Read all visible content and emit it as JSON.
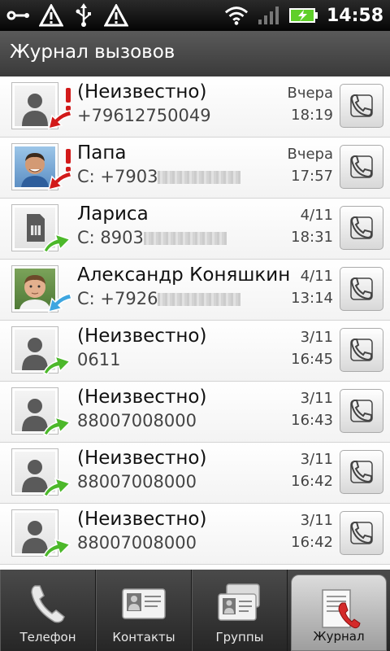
{
  "status_bar": {
    "time": "14:58",
    "icons": [
      "usb-debug-icon",
      "warning-icon",
      "usb-icon",
      "warning-icon",
      "wifi-icon",
      "signal-icon",
      "battery-charging-icon"
    ]
  },
  "header": {
    "title": "Журнал вызовов"
  },
  "call_log": [
    {
      "name": "(Неизвестно)",
      "number": "+79612750049",
      "number_hidden": false,
      "date": "Вчера",
      "time": "18:19",
      "type": "missed",
      "avatar": "silhouette"
    },
    {
      "name": "Папа",
      "number": "С: +7903",
      "number_hidden": true,
      "date": "Вчера",
      "time": "17:57",
      "type": "missed",
      "avatar": "photo-man"
    },
    {
      "name": "Лариса",
      "number": "С: 8903",
      "number_hidden": true,
      "date": "4/11",
      "time": "18:31",
      "type": "outgoing",
      "avatar": "sim-card"
    },
    {
      "name": "Александр Коняшкин",
      "number": "С: +7926",
      "number_hidden": true,
      "date": "4/11",
      "time": "13:14",
      "type": "incoming",
      "avatar": "photo-young-man"
    },
    {
      "name": "(Неизвестно)",
      "number": "0611",
      "number_hidden": false,
      "date": "3/11",
      "time": "16:45",
      "type": "outgoing",
      "avatar": "silhouette"
    },
    {
      "name": "(Неизвестно)",
      "number": "88007008000",
      "number_hidden": false,
      "date": "3/11",
      "time": "16:43",
      "type": "outgoing",
      "avatar": "silhouette"
    },
    {
      "name": "(Неизвестно)",
      "number": "88007008000",
      "number_hidden": false,
      "date": "3/11",
      "time": "16:42",
      "type": "outgoing",
      "avatar": "silhouette"
    },
    {
      "name": "(Неизвестно)",
      "number": "88007008000",
      "number_hidden": false,
      "date": "3/11",
      "time": "16:42",
      "type": "outgoing",
      "avatar": "silhouette"
    }
  ],
  "tabs": [
    {
      "label": "Телефон",
      "icon": "phone-handset-icon",
      "active": false
    },
    {
      "label": "Контакты",
      "icon": "contact-card-icon",
      "active": false
    },
    {
      "label": "Группы",
      "icon": "group-cards-icon",
      "active": false
    },
    {
      "label": "Журнал",
      "icon": "call-log-icon",
      "active": true
    }
  ],
  "colors": {
    "missed": "#d21a1a",
    "outgoing": "#4cb82a",
    "incoming": "#3ea6e0"
  }
}
